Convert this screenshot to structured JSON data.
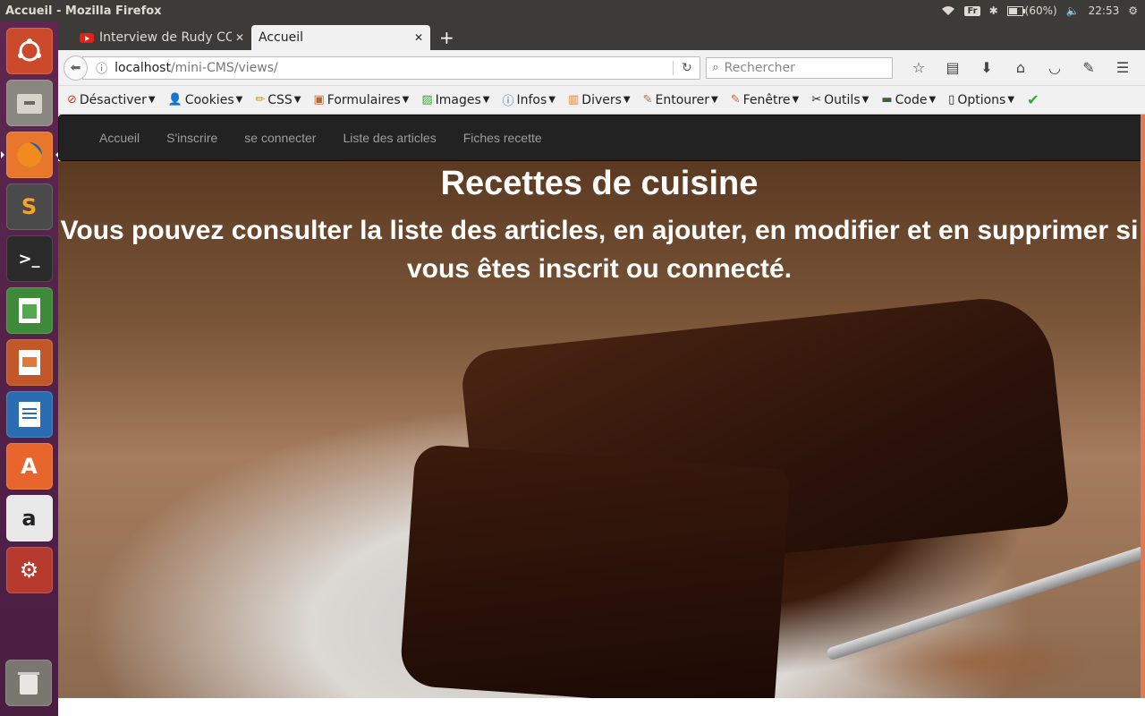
{
  "os_panel": {
    "window_title": "Accueil - Mozilla Firefox",
    "keyboard": "Fr",
    "battery": "(60%)",
    "time": "22:53"
  },
  "launcher": {
    "items": [
      "ubuntu-dash",
      "files",
      "firefox",
      "sublime-text",
      "terminal",
      "libreoffice-calc",
      "libreoffice-impress",
      "libreoffice-writer",
      "software-center",
      "amazon",
      "system-settings"
    ],
    "trash": "trash"
  },
  "tabs": [
    {
      "label": "Interview de Rudy COI",
      "active": false
    },
    {
      "label": "Accueil",
      "active": true
    }
  ],
  "navbar": {
    "url_host": "localhost",
    "url_path": "/mini-CMS/views/",
    "search_placeholder": "Rechercher"
  },
  "devbar": [
    {
      "label": "Désactiver",
      "icon": "stop-icon"
    },
    {
      "label": "Cookies",
      "icon": "person-icon"
    },
    {
      "label": "CSS",
      "icon": "pencil-icon"
    },
    {
      "label": "Formulaires",
      "icon": "form-icon"
    },
    {
      "label": "Images",
      "icon": "image-icon"
    },
    {
      "label": "Infos",
      "icon": "info-icon"
    },
    {
      "label": "Divers",
      "icon": "folder-icon"
    },
    {
      "label": "Entourer",
      "icon": "pen-icon"
    },
    {
      "label": "Fenêtre",
      "icon": "pen-icon"
    },
    {
      "label": "Outils",
      "icon": "tools-icon"
    },
    {
      "label": "Code",
      "icon": "code-icon"
    },
    {
      "label": "Options",
      "icon": "options-icon"
    }
  ],
  "site_nav": [
    "Accueil",
    "S'inscrire",
    "se connecter",
    "Liste des articles",
    "Fiches recette"
  ],
  "hero": {
    "title": "Recettes de cuisine",
    "subtitle": "Vous pouvez consulter la liste des articles, en ajouter, en modifier et en supprimer si vous êtes inscrit ou connecté."
  }
}
